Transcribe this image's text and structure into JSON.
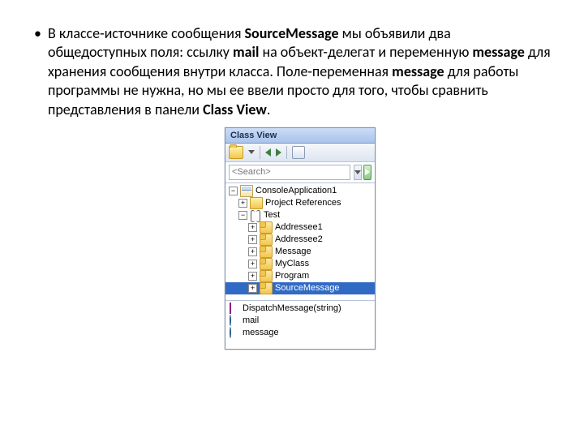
{
  "paragraph": {
    "prefix": "В классе-источнике сообщения ",
    "b1": "SourceMessage",
    "t1": " мы объявили два общедоступных поля: ссылку ",
    "b2": "mail",
    "t2": " на объект-делегат и переменную ",
    "b3": "message",
    "t3": " для хранения сообщения внутри класса. Поле-переменная ",
    "b4": "message",
    "t4": " для работы программы не нужна, но мы ее ввели просто для того, чтобы сравнить представления в панели ",
    "b5": "Class View",
    "t5": "."
  },
  "panel": {
    "title": "Class View",
    "search_placeholder": "<Search>",
    "tree": {
      "project": "ConsoleApplication1",
      "references": "Project References",
      "namespace": "Test",
      "classes": [
        "Addressee1",
        "Addressee2",
        "Message",
        "MyClass",
        "Program",
        "SourceMessage"
      ]
    },
    "members": [
      "DispatchMessage(string)",
      "mail",
      "message"
    ]
  }
}
